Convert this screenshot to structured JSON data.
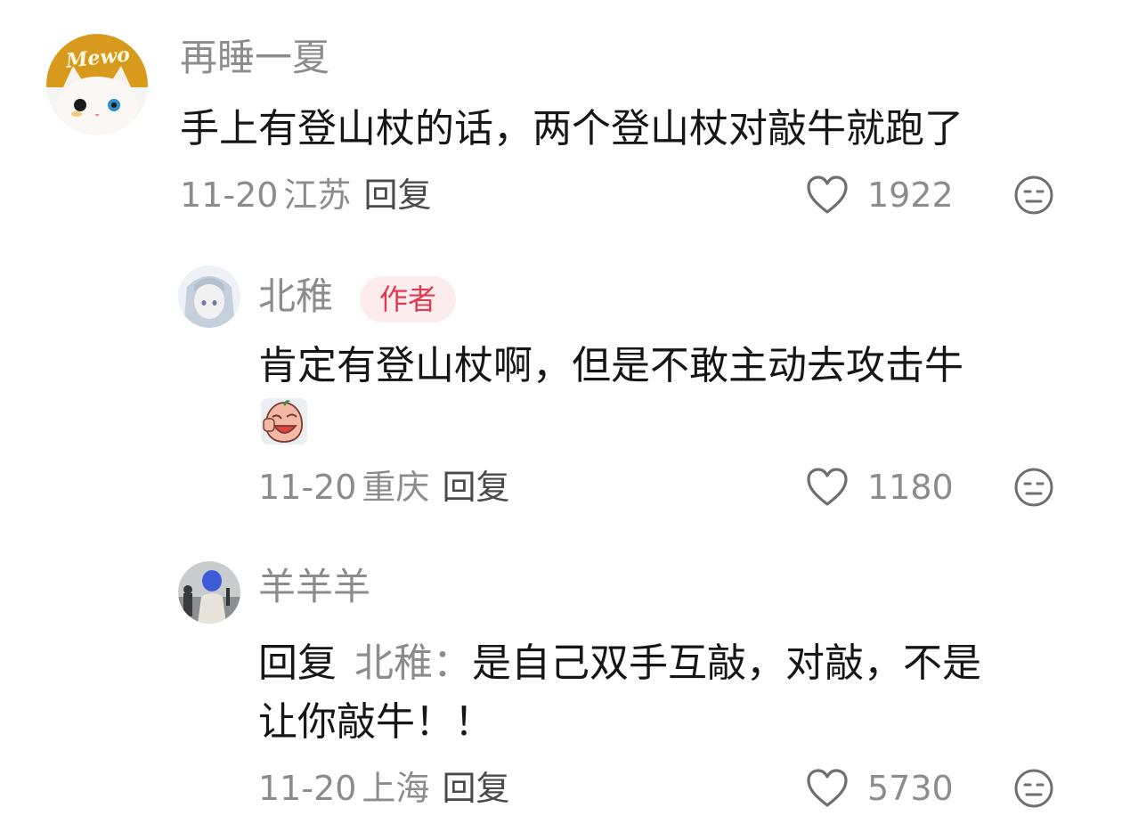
{
  "comments": [
    {
      "username": "再睡一夏",
      "avatar_text": "Mewo",
      "content": "手上有登山杖的话，两个登山杖对敲牛就跑了",
      "date": "11-20",
      "location": "江苏",
      "reply_label": "回复",
      "likes": "1922"
    },
    {
      "username": "北稚",
      "badge": "作者",
      "content": "肯定有登山杖啊，但是不敢主动去攻击牛",
      "date": "11-20",
      "location": "重庆",
      "reply_label": "回复",
      "likes": "1180"
    },
    {
      "username": "羊羊羊",
      "reply_prefix": "回复",
      "reply_target": "北稚：",
      "content_line1": "是自己双手互敲，对敲，不是",
      "content_line2": "让你敲牛！！",
      "date": "11-20",
      "location": "上海",
      "reply_label": "回复",
      "likes": "5730"
    }
  ],
  "icons": {
    "like": "heart-outline-icon",
    "dislike": "meh-face-icon",
    "sticker": "sticker-emoji"
  },
  "colors": {
    "badge_bg": "#fdecee",
    "badge_text": "#e03a52",
    "meta": "#8c8c8c"
  }
}
